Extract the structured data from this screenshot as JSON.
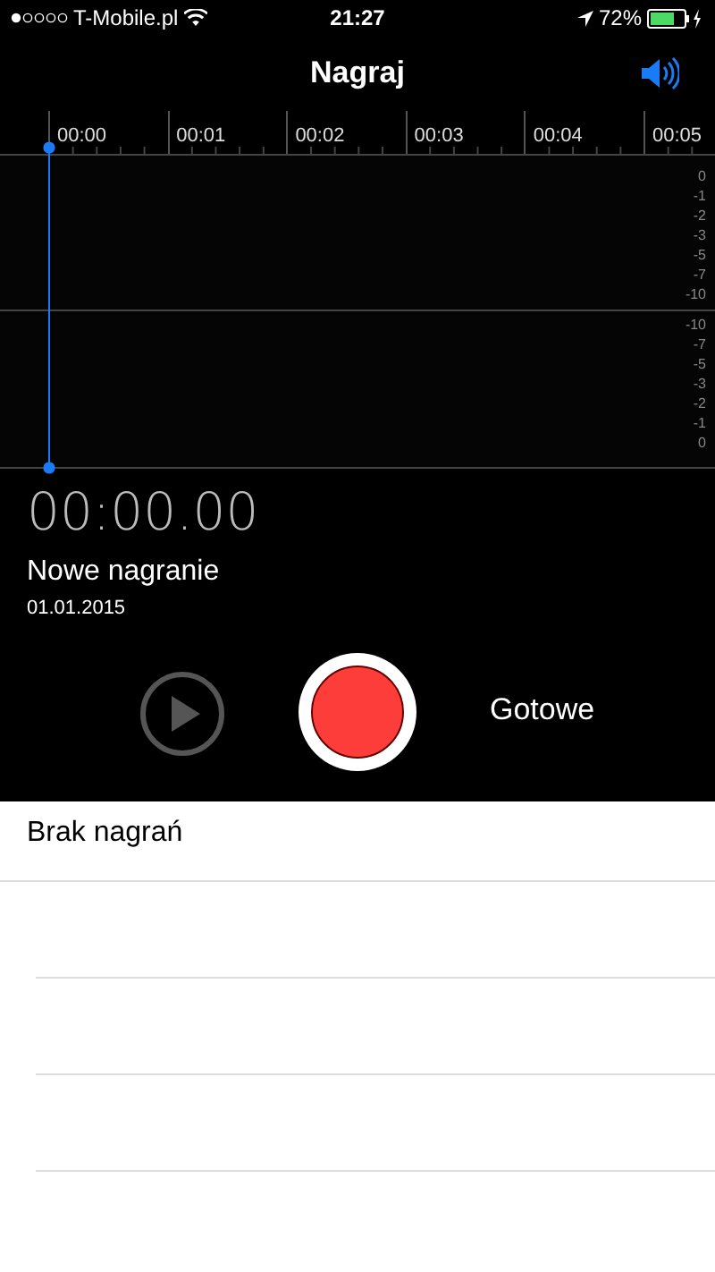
{
  "status_bar": {
    "carrier": "T-Mobile.pl",
    "time": "21:27",
    "battery": "72%"
  },
  "nav": {
    "title": "Nagraj"
  },
  "timeline": {
    "labels": [
      "00:00",
      "00:01",
      "00:02",
      "00:03",
      "00:04",
      "00:05"
    ]
  },
  "meter": {
    "top_labels": [
      "0",
      "-1",
      "-2",
      "-3",
      "-5",
      "-7",
      "-10"
    ],
    "bottom_labels": [
      "-10",
      "-7",
      "-5",
      "-3",
      "-2",
      "-1",
      "0"
    ]
  },
  "recording": {
    "elapsed": "00:00.00",
    "name": "Nowe nagranie",
    "date": "01.01.2015"
  },
  "controls": {
    "play_disabled": true,
    "done": "Gotowe"
  },
  "list": {
    "empty_message": "Brak nagrań"
  }
}
